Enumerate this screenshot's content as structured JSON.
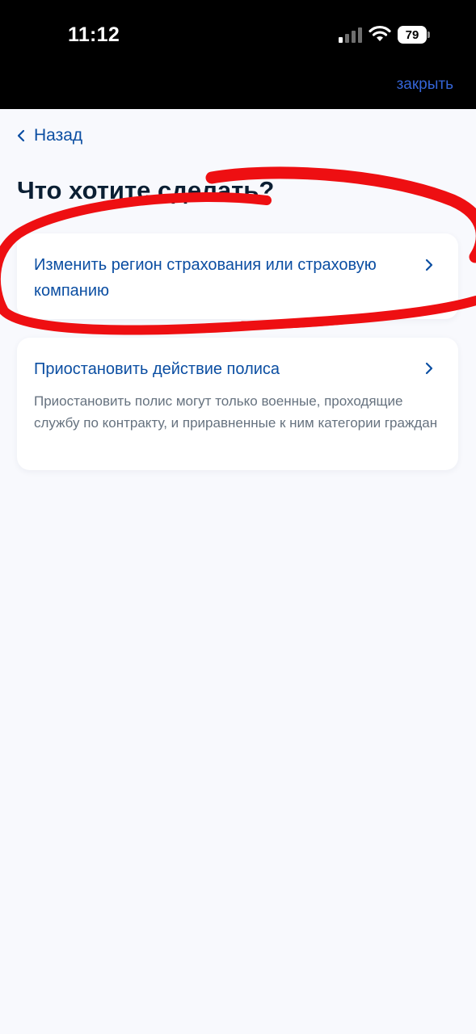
{
  "status_bar": {
    "time": "11:12",
    "battery_level": "79",
    "signal_icon": "cellular-signal-icon",
    "wifi_icon": "wifi-icon",
    "battery_icon": "battery-icon"
  },
  "header": {
    "close_label": "закрыть"
  },
  "nav": {
    "back_label": "Назад",
    "back_icon": "chevron-left-icon"
  },
  "page": {
    "title": "Что хотите сделать?"
  },
  "options": [
    {
      "title": "Изменить регион страхования или страховую компанию",
      "icon": "chevron-right-icon"
    },
    {
      "title": "Приостановить действие полиса",
      "description": "Приостановить полис могут только военные, проходящие службу по контракту, и приравненные к ним категории граждан",
      "icon": "chevron-right-icon"
    }
  ],
  "colors": {
    "link_blue": "#0b4ea2",
    "close_blue": "#3464d6",
    "background": "#f8f9fd",
    "annotation_red": "#ee0f12"
  }
}
